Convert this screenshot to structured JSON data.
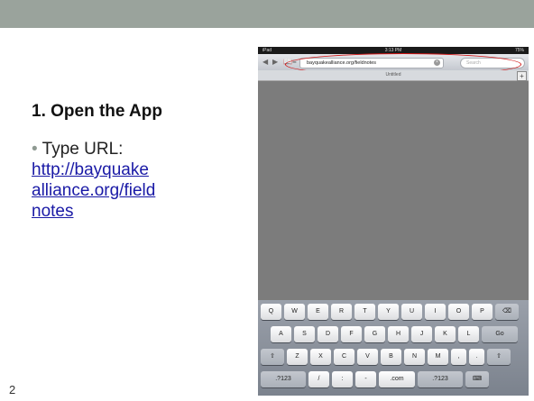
{
  "slide": {
    "heading": "1. Open the App",
    "bullet_label": "Type URL:",
    "url_lines": [
      "http://bayquake",
      "alliance.org/field",
      "notes"
    ],
    "page_number": "2"
  },
  "ipad": {
    "status": {
      "left": "iPad",
      "time": "3:13 PM",
      "battery": "75%"
    },
    "toolbar": {
      "back_icon": "◀",
      "forward_icon": "▶",
      "bookmarks_icon": "📖",
      "share_icon": "≡",
      "address": "bayquakealliance.org/fieldnotes",
      "search_placeholder": "Search"
    },
    "tab_label": "Untitled",
    "new_tab_icon": "+",
    "keyboard": {
      "row1": [
        "Q",
        "W",
        "E",
        "R",
        "T",
        "Y",
        "U",
        "I",
        "O",
        "P",
        "⌫"
      ],
      "row2": [
        "A",
        "S",
        "D",
        "F",
        "G",
        "H",
        "J",
        "K",
        "L",
        "Go"
      ],
      "row3": [
        "⇧",
        "Z",
        "X",
        "C",
        "V",
        "B",
        "N",
        "M",
        ",",
        ".",
        "⇧"
      ],
      "row4": [
        ".?123",
        "/",
        ":",
        "-",
        ".com",
        ".?123",
        "⌨"
      ]
    }
  },
  "colors": {
    "header_bar": "#9aa39c",
    "link": "#1a1aa6",
    "highlight": "#d01515"
  }
}
